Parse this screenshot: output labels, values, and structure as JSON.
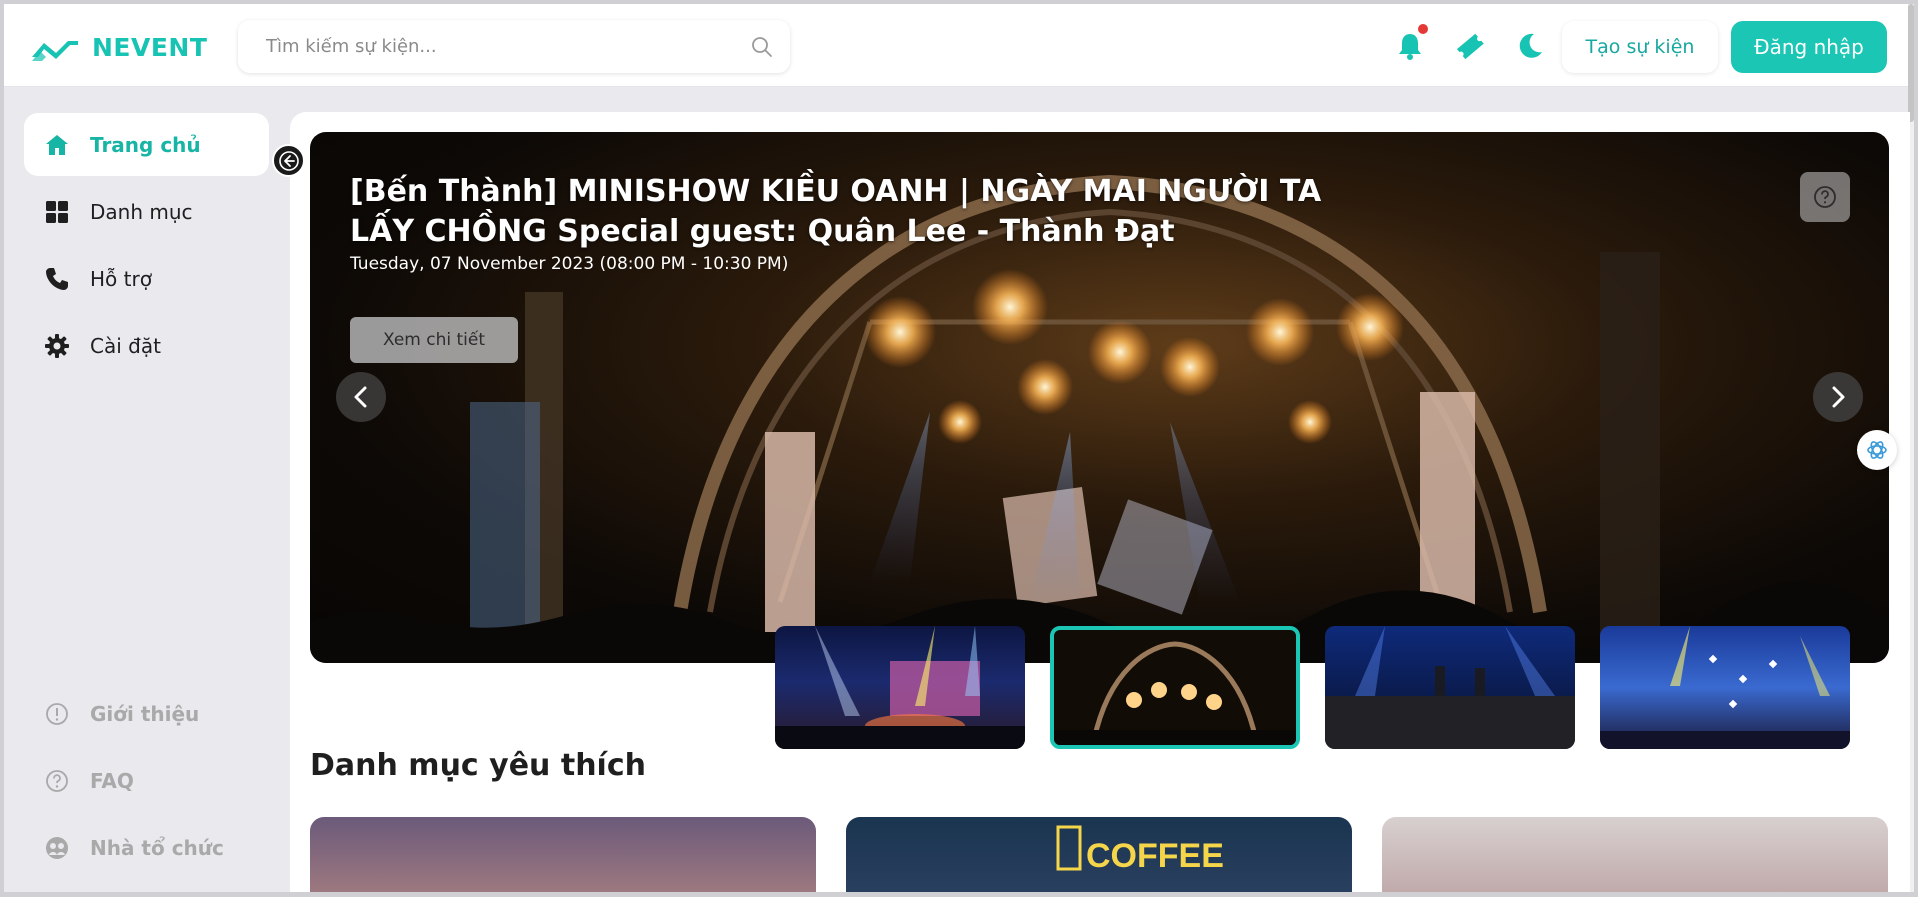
{
  "header": {
    "logo_text": "NEVENT",
    "search_placeholder": "Tìm kiếm sự kiện...",
    "create_event_label": "Tạo sự kiện",
    "login_label": "Đăng nhập",
    "icons": [
      "bell-icon",
      "ticket-icon",
      "moon-icon",
      "search-icon"
    ]
  },
  "sidebar": {
    "items": [
      {
        "label": "Trang chủ",
        "icon": "home-icon",
        "active": true
      },
      {
        "label": "Danh mục",
        "icon": "grid-icon"
      },
      {
        "label": "Hỗ trợ",
        "icon": "phone-icon"
      },
      {
        "label": "Cài đặt",
        "icon": "gear-icon"
      }
    ],
    "footer_items": [
      {
        "label": "Giới thiệu",
        "icon": "info-icon"
      },
      {
        "label": "FAQ",
        "icon": "question-icon"
      },
      {
        "label": "Nhà tổ chức",
        "icon": "organizer-icon"
      }
    ]
  },
  "hero": {
    "title": "[Bến Thành] MINISHOW KIỀU OANH | NGÀY MAI NGƯỜI TA LẤY CHỒNG Special guest: Quân Lee - Thành Đạt",
    "date": "Tuesday, 07 November 2023 (08:00 PM - 10:30 PM)",
    "button_label": "Xem chi tiết",
    "active_thumbnail": 2
  },
  "sections": {
    "favorite_categories_title": "Danh mục yêu thích",
    "coffee_sign_text": "COFFEE"
  },
  "colors": {
    "accent": "#1bc6b4",
    "accent_text": "#17b5a5",
    "notification_dot": "#e53935"
  }
}
